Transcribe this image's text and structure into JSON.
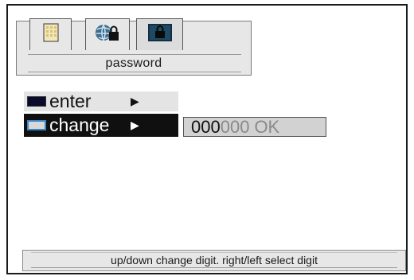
{
  "tabbar": {
    "title": "password",
    "tabs": [
      {
        "icon": "grid-settings-icon"
      },
      {
        "icon": "globe-lock-icon"
      },
      {
        "icon": "lock-icon"
      }
    ]
  },
  "menu": {
    "items": [
      {
        "label": "enter",
        "arrow": "▶",
        "icon": "remote-icon"
      },
      {
        "label": "change",
        "arrow": "▶",
        "icon": "keyboard-icon"
      }
    ]
  },
  "password": {
    "entered": "000",
    "pending": "000",
    "ok": "OK"
  },
  "status": {
    "text": "up/down change digit. right/left select digit"
  }
}
